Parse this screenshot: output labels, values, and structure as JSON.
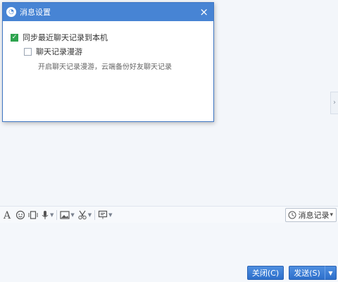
{
  "dialog": {
    "title": "消息设置",
    "close_glyph": "×",
    "options": [
      {
        "label": "同步最近聊天记录到本机",
        "checked": true
      },
      {
        "label": "聊天记录漫游",
        "checked": false
      }
    ],
    "description": "开启聊天记录漫游，云端备份好友聊天记录"
  },
  "side_handle": {
    "glyph": "›"
  },
  "toolbar": {
    "icons": [
      "font-icon",
      "emoji-icon",
      "window-shake-icon",
      "voice-icon",
      "image-icon",
      "scissors-icon",
      "screen-share-icon"
    ],
    "history_label": "消息记录",
    "history_caret": "▾"
  },
  "footer": {
    "close_label": "关闭(C)",
    "send_label": "发送(S)",
    "send_arrow": "▼"
  },
  "colors": {
    "title_bar": "#4784d4",
    "button": "#2d6fcb",
    "check": "#2ea44f"
  }
}
